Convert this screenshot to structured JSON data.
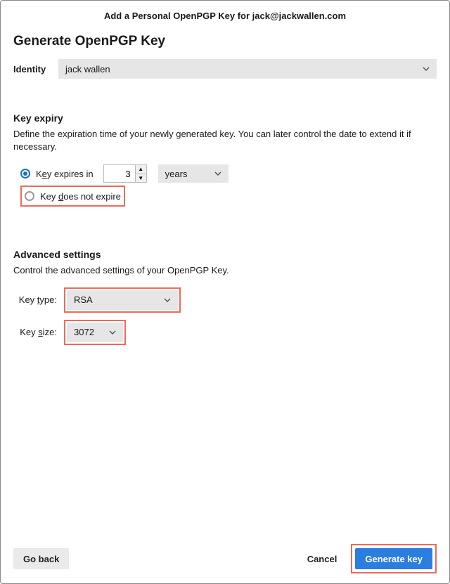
{
  "window": {
    "title": "Add a Personal OpenPGP Key for jack@jackwallen.com",
    "page_title": "Generate OpenPGP Key"
  },
  "identity": {
    "label": "Identity",
    "selected": "jack wallen"
  },
  "expiry": {
    "section_title": "Key expiry",
    "desc": "Define the expiration time of your newly generated key. You can later control the date to extend it if necessary.",
    "opt_expires_pre": "K",
    "opt_expires_u": "e",
    "opt_expires_post": "y expires in",
    "num_value": "3",
    "unit": "years",
    "opt_noexpire_pre": "Key ",
    "opt_noexpire_u": "d",
    "opt_noexpire_post": "oes not expire"
  },
  "advanced": {
    "section_title": "Advanced settings",
    "desc": "Control the advanced settings of your OpenPGP Key.",
    "keytype_label_pre": "Key ",
    "keytype_label_u": "t",
    "keytype_label_post": "ype:",
    "keytype_value": "RSA",
    "keysize_label_pre": "Key ",
    "keysize_label_u": "s",
    "keysize_label_post": "ize:",
    "keysize_value": "3072"
  },
  "footer": {
    "go_back": "Go back",
    "cancel": "Cancel",
    "generate": "Generate key"
  },
  "colors": {
    "highlight": "#ed6a5a",
    "primary": "#2b7de0"
  }
}
